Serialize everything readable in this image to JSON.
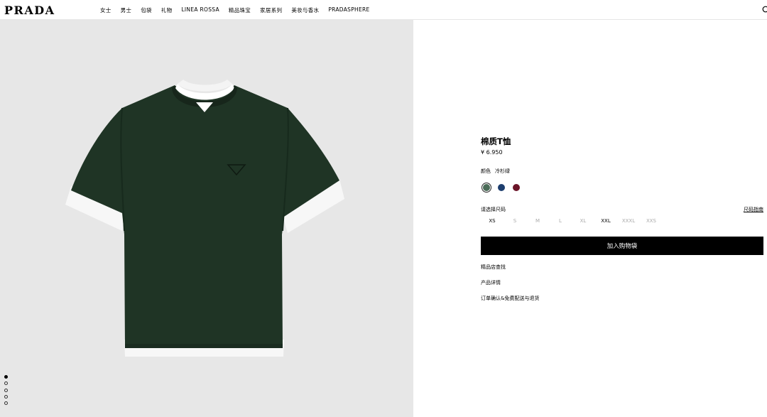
{
  "header": {
    "logo": "PRADA",
    "nav": [
      "女士",
      "男士",
      "包袋",
      "礼物",
      "LINEA ROSSA",
      "精品珠宝",
      "家居系列",
      "美妆与香水",
      "PRADASPHERE"
    ]
  },
  "gallery": {
    "dot_count": 5,
    "active_index": 0
  },
  "product": {
    "title": "棉质T恤",
    "price": "¥ 6.950",
    "color_label": "颜色",
    "color_value": "冷杉绿",
    "swatches": [
      {
        "name": "冷杉绿",
        "hex": "#4a6b57",
        "selected": true
      },
      {
        "name": "navy",
        "hex": "#1d3e6e",
        "selected": false
      },
      {
        "name": "burgundy",
        "hex": "#6b1428",
        "selected": false
      }
    ],
    "size_label": "请选择尺码",
    "size_guide": "尺码指南",
    "sizes": [
      "XS",
      "S",
      "M",
      "L",
      "XL",
      "XXL",
      "XXXL",
      "XXS"
    ],
    "sizes_available": [
      "XS",
      "XXL"
    ],
    "add_to_bag": "加入购物袋",
    "links": [
      "精品店查找",
      "产品详情",
      "订单确认&免费配送与退货"
    ]
  },
  "colors": {
    "background_gallery": "#e7e7e7",
    "shirt": "#1f3425",
    "cta": "#000000"
  }
}
